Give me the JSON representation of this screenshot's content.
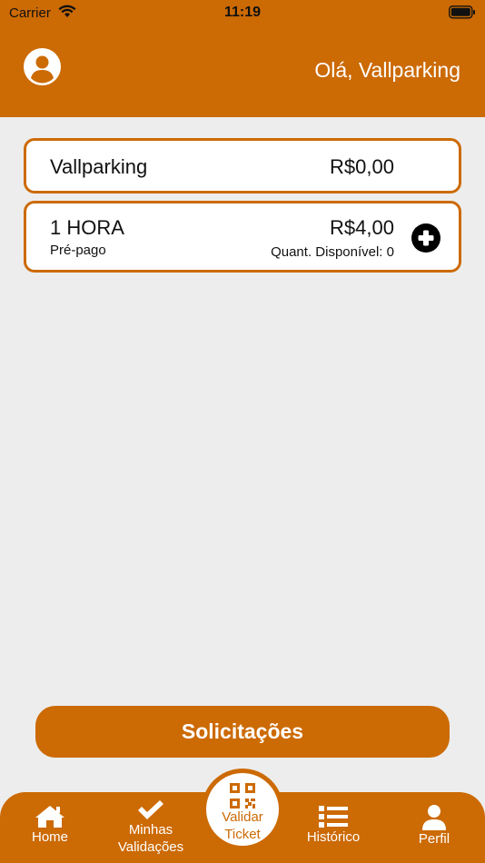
{
  "status_bar": {
    "carrier": "Carrier",
    "time": "11:19"
  },
  "header": {
    "greeting": "Olá, Vallparking"
  },
  "balance_card": {
    "name": "Vallparking",
    "value": "R$0,00"
  },
  "products": [
    {
      "title": "1 HORA",
      "subtitle": "Pré-pago",
      "price": "R$4,00",
      "quantity_label": "Quant. Disponível: 0"
    }
  ],
  "actions": {
    "solicitacoes": "Solicitações"
  },
  "tabbar": {
    "home": "Home",
    "minhas_line1": "Minhas",
    "minhas_line2": "Validações",
    "validar_line1": "Validar",
    "validar_line2": "Ticket",
    "historico": "Histórico",
    "perfil": "Perfil"
  },
  "colors": {
    "brand": "#cc6a04",
    "background": "#ededed",
    "card": "#ffffff"
  },
  "icons": [
    "user-circle-icon",
    "wifi-icon",
    "battery-icon",
    "plus-circle-icon",
    "home-icon",
    "check-icon",
    "qr-code-icon",
    "list-icon",
    "person-icon"
  ]
}
